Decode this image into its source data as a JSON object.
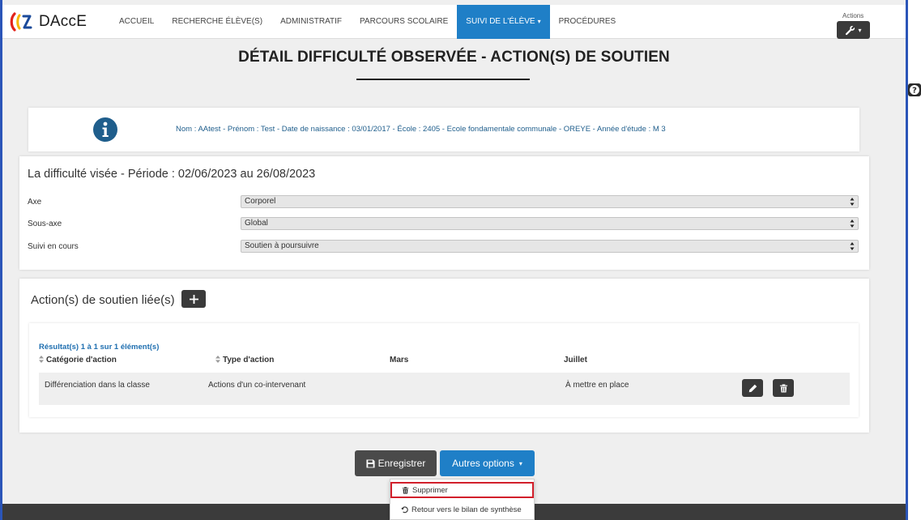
{
  "brand": {
    "name": "DAccE"
  },
  "nav": {
    "items": [
      {
        "label": "ACCUEIL"
      },
      {
        "label": "RECHERCHE ÉLÈVE(S)"
      },
      {
        "label": "ADMINISTRATIF"
      },
      {
        "label": "PARCOURS SCOLAIRE"
      },
      {
        "label": "SUIVI DE L'ÉLÈVE"
      },
      {
        "label": "PROCÉDURES"
      }
    ],
    "actions_label": "Actions"
  },
  "page": {
    "title": "DÉTAIL DIFFICULTÉ OBSERVÉE - ACTION(S) DE SOUTIEN"
  },
  "info": {
    "text": "Nom : AAtest - Prénom : Test - Date de naissance : 03/01/2017 - École : 2405 - Ecole fondamentale communale - OREYE - Année d'étude : M 3"
  },
  "difficulty": {
    "title": "La difficulté visée - Période : 02/06/2023 au 26/08/2023",
    "fields": [
      {
        "label": "Axe",
        "value": "Corporel"
      },
      {
        "label": "Sous-axe",
        "value": "Global"
      },
      {
        "label": "Suivi en cours",
        "value": "Soutien à poursuivre"
      }
    ]
  },
  "actions": {
    "title": "Action(s) de soutien liée(s)",
    "results_count": "Résultat(s) 1 à 1 sur 1 élément(s)",
    "columns": [
      "Catégorie d'action",
      "Type d'action",
      "Mars",
      "Juillet"
    ],
    "rows": [
      {
        "category": "Différenciation dans la classe",
        "type": "Actions d'un co-intervenant",
        "mars": "",
        "juillet": "À mettre en place"
      }
    ]
  },
  "buttons": {
    "save": "Enregistrer",
    "more": "Autres options"
  },
  "dropdown": {
    "items": [
      {
        "label": "Supprimer"
      },
      {
        "label": "Retour vers le bilan de synthèse"
      }
    ]
  },
  "colors": {
    "accent": "#1f7fc7",
    "frame": "#2b55b8",
    "highlight": "#d21f2b",
    "dark_button": "#3a3a3a"
  }
}
